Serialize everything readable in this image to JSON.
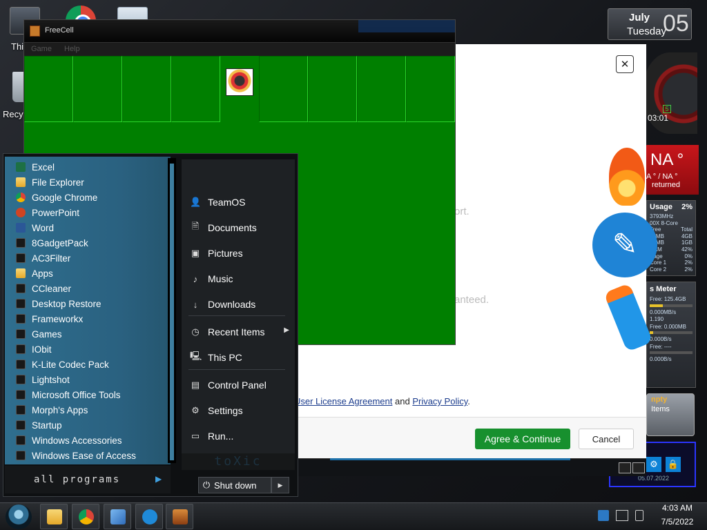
{
  "desktop": {
    "icons": [
      {
        "label": "This"
      },
      {
        "label": "Recy"
      }
    ]
  },
  "gadgets": {
    "date": {
      "month": "July",
      "weekday": "Tuesday",
      "day": "05"
    },
    "clock": {
      "time": "03:01",
      "badge": "5"
    },
    "weather": {
      "temp": "NA °",
      "sub": "A ° / NA °",
      "returned": "returned"
    },
    "cpu": {
      "title": "Usage",
      "percent": "2%",
      "rows": [
        {
          "a": "3793MHz",
          "b": ""
        },
        {
          "a": "00X 8-Core",
          "b": ""
        },
        {
          "a": "Free",
          "b": "Total"
        },
        {
          "a": "67MB",
          "b": "4GB"
        },
        {
          "a": "08MB",
          "b": "1GB"
        },
        {
          "a": "RAM",
          "b": "42%"
        },
        {
          "a": "Page",
          "b": "0%"
        },
        {
          "a": "Core 1",
          "b": "2%"
        },
        {
          "a": "Core 2",
          "b": "2%"
        }
      ]
    },
    "drive": {
      "title": "s Meter",
      "rows": [
        "Free: 125.4GB",
        "0.000MB/s",
        "1.190",
        "Free: 0.000MB",
        "0.000B/s",
        "Free: ----",
        "0.000B/s"
      ]
    },
    "recycle": {
      "title": "npty",
      "items": "Items"
    },
    "lock": {
      "date": "05.07.2022"
    }
  },
  "dialog": {
    "faint1": "ort.",
    "faint2": "anteed.",
    "eula_link": "User License Agreement",
    "eula_and": "and",
    "privacy_link": "Privacy Policy",
    "eula_end": ".",
    "agree_label": "Agree & Continue",
    "cancel_label": "Cancel",
    "close_glyph": "✕"
  },
  "freecell": {
    "title": "FreeCell",
    "menu": [
      "Game",
      "Help"
    ],
    "cells": 9
  },
  "start_menu": {
    "programs": [
      {
        "label": "Excel",
        "icon": "excel-icon"
      },
      {
        "label": "File Explorer",
        "icon": "folder-icon"
      },
      {
        "label": "Google Chrome",
        "icon": "chrome-icon"
      },
      {
        "label": "PowerPoint",
        "icon": "powerpoint-icon"
      },
      {
        "label": "Word",
        "icon": "word-icon"
      },
      {
        "label": "8GadgetPack",
        "icon": "app-icon"
      },
      {
        "label": "AC3Filter",
        "icon": "app-icon"
      },
      {
        "label": "Apps",
        "icon": "folder-icon"
      },
      {
        "label": "CCleaner",
        "icon": "app-icon"
      },
      {
        "label": "Desktop Restore",
        "icon": "app-icon"
      },
      {
        "label": "Frameworkx",
        "icon": "app-icon"
      },
      {
        "label": "Games",
        "icon": "app-icon"
      },
      {
        "label": "IObit",
        "icon": "app-icon"
      },
      {
        "label": "K-Lite Codec Pack",
        "icon": "app-icon"
      },
      {
        "label": "Lightshot",
        "icon": "app-icon"
      },
      {
        "label": "Microsoft Office Tools",
        "icon": "app-icon"
      },
      {
        "label": "Morph's Apps",
        "icon": "app-icon"
      },
      {
        "label": "Startup",
        "icon": "app-icon"
      },
      {
        "label": "Windows Accessories",
        "icon": "app-icon"
      },
      {
        "label": "Windows Ease of Access",
        "icon": "app-icon"
      }
    ],
    "all_programs": "all programs",
    "right_items": [
      {
        "label": "TeamOS",
        "icon": "user-icon"
      },
      {
        "label": "Documents",
        "icon": "document-icon"
      },
      {
        "label": "Pictures",
        "icon": "picture-icon"
      },
      {
        "label": "Music",
        "icon": "music-icon"
      },
      {
        "label": "Downloads",
        "icon": "download-icon"
      },
      {
        "label": "Recent Items",
        "icon": "clock-icon"
      },
      {
        "label": "This PC",
        "icon": "computer-icon"
      },
      {
        "label": "Control Panel",
        "icon": "control-panel-icon"
      },
      {
        "label": "Settings",
        "icon": "gear-icon"
      },
      {
        "label": "Run...",
        "icon": "run-icon"
      }
    ],
    "brand": "toXic",
    "shutdown_label": "Shut down"
  },
  "taskbar": {
    "time": "4:03 AM",
    "date": "7/5/2022"
  }
}
